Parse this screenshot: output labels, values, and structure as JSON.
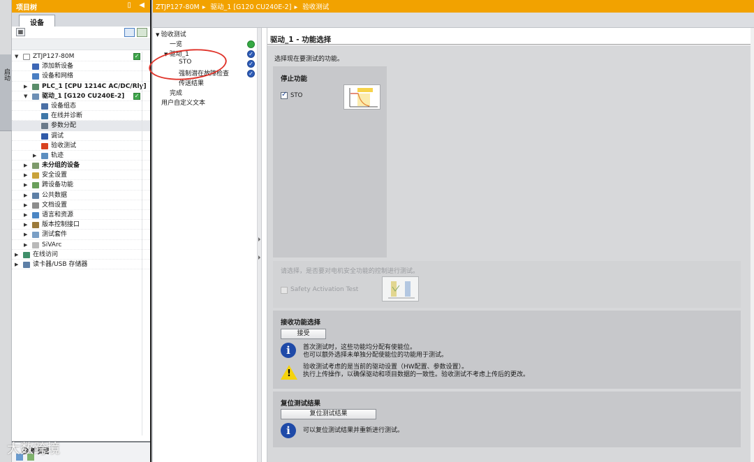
{
  "side_strip": {
    "tab_label": "启动"
  },
  "project_tree": {
    "title": "项目树",
    "tab": "设备",
    "items": [
      {
        "label": "ZTJP127-80M",
        "indent": 0,
        "arrow": "▼",
        "icon": "project-icon",
        "color": "#ffffff",
        "bold": false,
        "check": true
      },
      {
        "label": "添加新设备",
        "indent": 1,
        "arrow": "",
        "icon": "add-device-icon",
        "color": "#3c66b5",
        "bold": false,
        "check": false
      },
      {
        "label": "设备和网络",
        "indent": 1,
        "arrow": "",
        "icon": "network-icon",
        "color": "#4a7ec2",
        "bold": false,
        "check": false
      },
      {
        "label": "PLC_1 [CPU 1214C AC/DC/Rly]",
        "indent": 1,
        "arrow": "▶",
        "icon": "plc-icon",
        "color": "#5a8d6a",
        "bold": true,
        "check": false
      },
      {
        "label": "驱动_1 [G120 CU240E-2]",
        "indent": 1,
        "arrow": "▼",
        "icon": "drive-icon",
        "color": "#6d8fb5",
        "bold": true,
        "check": true
      },
      {
        "label": "设备组态",
        "indent": 2,
        "arrow": "",
        "icon": "device-config-icon",
        "color": "#4a6fa5",
        "bold": false,
        "check": false
      },
      {
        "label": "在线并诊断",
        "indent": 2,
        "arrow": "",
        "icon": "online-diag-icon",
        "color": "#3f77a8",
        "bold": false,
        "check": false
      },
      {
        "label": "参数分配",
        "indent": 2,
        "arrow": "",
        "icon": "parameter-icon",
        "color": "#6a7a8a",
        "bold": false,
        "check": false,
        "selected": true
      },
      {
        "label": "调试",
        "indent": 2,
        "arrow": "",
        "icon": "commissioning-icon",
        "color": "#2f5aa8",
        "bold": false,
        "check": false
      },
      {
        "label": "验收测试",
        "indent": 2,
        "arrow": "",
        "icon": "acceptance-test-icon",
        "color": "#d8421f",
        "bold": false,
        "check": false
      },
      {
        "label": "轨迹",
        "indent": 2,
        "arrow": "▶",
        "icon": "trace-icon",
        "color": "#5b8ec0",
        "bold": false,
        "check": false
      },
      {
        "label": "未分组的设备",
        "indent": 1,
        "arrow": "▶",
        "icon": "ungrouped-devices-icon",
        "color": "#7d9a6b",
        "bold": true,
        "check": false
      },
      {
        "label": "安全设置",
        "indent": 1,
        "arrow": "▶",
        "icon": "security-icon",
        "color": "#c9a23a",
        "bold": false,
        "check": false
      },
      {
        "label": "跨设备功能",
        "indent": 1,
        "arrow": "▶",
        "icon": "cross-device-icon",
        "color": "#6a9f5b",
        "bold": false,
        "check": false
      },
      {
        "label": "公共数据",
        "indent": 1,
        "arrow": "▶",
        "icon": "common-data-icon",
        "color": "#5d7fa6",
        "bold": false,
        "check": false
      },
      {
        "label": "文档设置",
        "indent": 1,
        "arrow": "▶",
        "icon": "document-settings-icon",
        "color": "#8c8c8c",
        "bold": false,
        "check": false
      },
      {
        "label": "语言和资源",
        "indent": 1,
        "arrow": "▶",
        "icon": "language-icon",
        "color": "#4b86c4",
        "bold": false,
        "check": false
      },
      {
        "label": "版本控制接口",
        "indent": 1,
        "arrow": "▶",
        "icon": "version-control-icon",
        "color": "#9c7a3a",
        "bold": false,
        "check": false
      },
      {
        "label": "测试套件",
        "indent": 1,
        "arrow": "▶",
        "icon": "test-suite-icon",
        "color": "#7a9fc6",
        "bold": false,
        "check": false
      },
      {
        "label": "SiVArc",
        "indent": 1,
        "arrow": "▶",
        "icon": "sivarc-icon",
        "color": "#b9b9b9",
        "bold": false,
        "check": false
      },
      {
        "label": "在线访问",
        "indent": 0,
        "arrow": "▶",
        "icon": "online-access-icon",
        "color": "#3f8f6a",
        "bold": false,
        "check": false
      },
      {
        "label": "读卡器/USB 存储器",
        "indent": 0,
        "arrow": "▶",
        "icon": "card-reader-icon",
        "color": "#5d7fa6",
        "bold": false,
        "check": false
      }
    ],
    "reference_label": "参考项目"
  },
  "main": {
    "breadcrumb": [
      "ZTJP127-80M",
      "驱动_1 [G120 CU240E-2]",
      "验收测试"
    ],
    "steps": [
      {
        "label": "验收测试",
        "arrow": "▼",
        "status": ""
      },
      {
        "label": "一览",
        "arrow": "",
        "status": "green"
      },
      {
        "label": "驱动_1",
        "arrow": "▼",
        "status": "blue"
      },
      {
        "label": "STO",
        "arrow": "",
        "status": "blue"
      },
      {
        "label": "强制潜在故障检查",
        "arrow": "",
        "status": "blue"
      },
      {
        "label": "传送结果",
        "arrow": "",
        "status": ""
      },
      {
        "label": "完成",
        "arrow": "",
        "status": ""
      },
      {
        "label": "用户自定义文本",
        "arrow": "",
        "status": ""
      }
    ],
    "content_title": "驱动_1 - 功能选择",
    "intro": "选择现在要测试的功能。",
    "stop_function": {
      "title": "停止功能",
      "option": "STO"
    },
    "safety_activation": {
      "question": "请选择，是否要对电机安全功能的控制进行测试。",
      "option": "Safety Activation Test"
    },
    "accept_section": {
      "title": "接收功能选择",
      "button": "接受",
      "info_line1": "首次测试时，这些功能均分配有使能位。",
      "info_line2": "也可以额外选择未单独分配使能位的功能用于测试。",
      "warn_line1": "验收测试考虑的是当前的驱动设置（HW配置、参数设置）。",
      "warn_line2": "执行上传操作，以确保驱动和项目数据的一致性。验收测试不考虑上传后的更改。"
    },
    "reset_section": {
      "title": "复位测试结果",
      "button": "复位测试结果",
      "info": "可以复位测试结果并重新进行测试。"
    }
  },
  "watermark": "大数跨境",
  "colors": {
    "accent": "#f2a200",
    "check_green": "#3fa64b",
    "status_blue": "#2d5bb6",
    "highlight_red": "#e0342b"
  }
}
